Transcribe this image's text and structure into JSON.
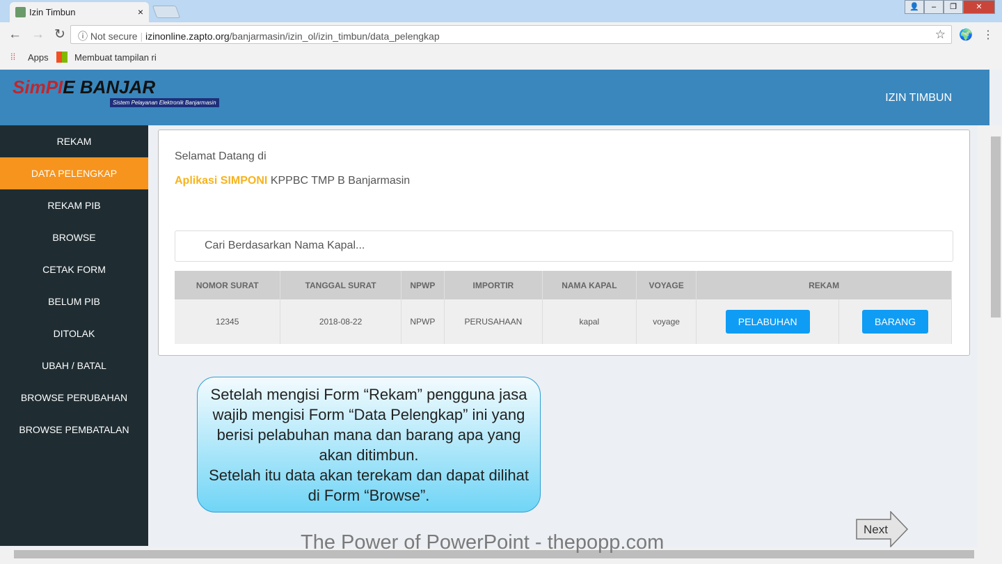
{
  "browser": {
    "tab_title": "Izin Timbun",
    "tab_close": "×",
    "security": "Not secure",
    "url_host": "izinonline.zapto.org",
    "url_path": "/banjarmasin/izin_ol/izin_timbun/data_pelengkap",
    "bookmarks": [
      "Apps",
      "Membuat tampilan ri"
    ]
  },
  "header": {
    "logo": "SimPIE BANJAR",
    "logo_sub": "Sistem Pelayanan Elektronik Banjarmasin",
    "title": "IZIN TIMBUN"
  },
  "sidebar": {
    "items": [
      {
        "label": "REKAM"
      },
      {
        "label": "DATA PELENGKAP",
        "active": true
      },
      {
        "label": "REKAM PIB"
      },
      {
        "label": "BROWSE"
      },
      {
        "label": "CETAK FORM"
      },
      {
        "label": "BELUM PIB"
      },
      {
        "label": "DITOLAK"
      },
      {
        "label": "UBAH / BATAL"
      },
      {
        "label": "BROWSE PERUBAHAN"
      },
      {
        "label": "BROWSE PEMBATALAN"
      }
    ]
  },
  "main": {
    "welcome": "Selamat Datang di",
    "app_highlight": "Aplikasi SIMPONI",
    "app_rest": " KPPBC TMP B Banjarmasin",
    "search_placeholder": "Cari Berdasarkan Nama Kapal...",
    "table": {
      "headers": [
        "NOMOR SURAT",
        "TANGGAL SURAT",
        "NPWP",
        "IMPORTIR",
        "NAMA KAPAL",
        "VOYAGE",
        "REKAM"
      ],
      "row": {
        "nomor": "12345",
        "tanggal": "2018-08-22",
        "npwp": "NPWP",
        "importir": "PERUSAHAAN",
        "kapal": "kapal",
        "voyage": "voyage",
        "btn1": "PELABUHAN",
        "btn2": "BARANG"
      }
    }
  },
  "callout": {
    "lines": [
      "Setelah mengisi Form “Rekam” pengguna jasa wajib mengisi Form “Data Pelengkap” ini yang berisi pelabuhan mana dan barang apa yang akan ditimbun.",
      "Setelah itu data akan terekam dan dapat dilihat di Form “Browse”."
    ]
  },
  "next_label": "Next",
  "footer": "The Power of PowerPoint - thepopp.com",
  "colors": {
    "header": "#3a87bd",
    "sidebar": "#1f2d33",
    "active": "#f7941d",
    "button": "#0f9cf5"
  }
}
